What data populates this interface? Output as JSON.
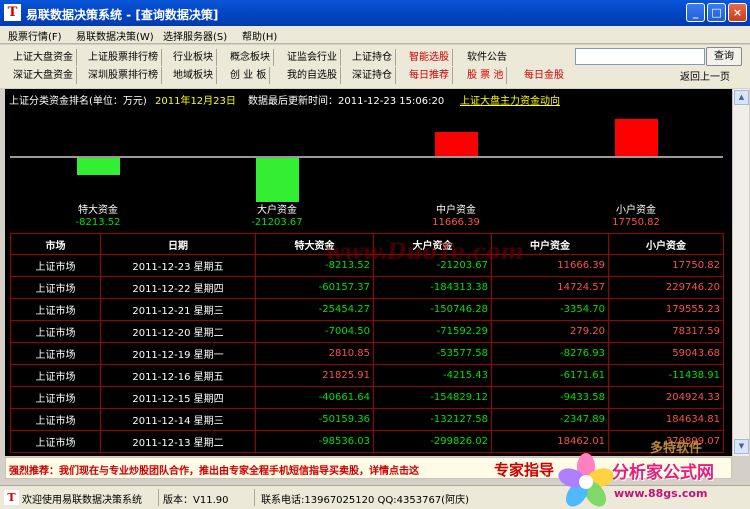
{
  "window": {
    "title": "易联数据决策系统 - [查询数据决策]",
    "buttons": {
      "minimize": "_",
      "maximize": "□",
      "close": "×"
    }
  },
  "menu": [
    "股票行情(F)",
    "易联数据决策(W)",
    "选择服务器(S)",
    "帮助(H)"
  ],
  "toolbar": {
    "row1": [
      "上证大盘资金",
      "上证股票排行榜",
      "行业板块",
      "概念板块",
      "证监会行业",
      "上证持仓",
      "智能选股",
      "软件公告"
    ],
    "row2": [
      "深证大盘资金",
      "深圳股票排行榜",
      "地域板块",
      "创 业 板",
      "我的自选股",
      "深证持仓",
      "每日推荐",
      "股 票 池",
      "每日金股"
    ],
    "search_value": "",
    "search_button": "查询",
    "back_link": "返回上一页"
  },
  "info": {
    "label": "上证分类资金排名(单位：万元)",
    "date": "2011年12月23日",
    "updated": "数据最后更新时间：2011-12-23 15:06:20",
    "link": "上证大盘主力资金动向"
  },
  "chart_data": {
    "type": "bar",
    "categories": [
      "特大资金",
      "大户资金",
      "中户资金",
      "小户资金"
    ],
    "values": [
      -8213.52,
      -21203.67,
      11666.39,
      17750.82
    ],
    "value_labels": [
      "-8213.52",
      "-21203.67",
      "11666.39",
      "17750.82"
    ],
    "colors": {
      "positive": "#ff0000",
      "negative": "#33ee33"
    }
  },
  "table": {
    "headers": [
      "市场",
      "日期",
      "特大资金",
      "大户资金",
      "中户资金",
      "小户资金"
    ],
    "rows": [
      [
        "上证市场",
        "2011-12-23  星期五",
        "-8213.52",
        "-21203.67",
        "11666.39",
        "17750.82"
      ],
      [
        "上证市场",
        "2011-12-22  星期四",
        "-60157.37",
        "-184313.38",
        "14724.57",
        "229746.20"
      ],
      [
        "上证市场",
        "2011-12-21  星期三",
        "-25454.27",
        "-150746.28",
        "-3354.70",
        "179555.23"
      ],
      [
        "上证市场",
        "2011-12-20  星期二",
        "-7004.50",
        "-71592.29",
        "279.20",
        "78317.59"
      ],
      [
        "上证市场",
        "2011-12-19  星期一",
        "2810.85",
        "-53577.58",
        "-8276.93",
        "59043.68"
      ],
      [
        "上证市场",
        "2011-12-16  星期五",
        "21825.91",
        "-4215.43",
        "-6171.61",
        "-11438.91"
      ],
      [
        "上证市场",
        "2011-12-15  星期四",
        "-40661.64",
        "-154829.12",
        "-9433.58",
        "204924.33"
      ],
      [
        "上证市场",
        "2011-12-14  星期三",
        "-50159.36",
        "-132127.58",
        "-2347.89",
        "184634.81"
      ],
      [
        "上证市场",
        "2011-12-13  星期二",
        "-98536.03",
        "-299826.02",
        "18462.01",
        "379899.07"
      ]
    ]
  },
  "watermark": "www.DuoTe.com",
  "banner": {
    "text": "强烈推荐：我们现在与专业炒股团队合作，推出由专家全程手机短信指导买卖股，详情点击这",
    "tag": "专家指导"
  },
  "status": {
    "welcome": "欢迎使用易联数据决策系统",
    "version": "版本：V11.90",
    "contact": "联系电话:13967025120 QQ:4353767(阿庆)"
  },
  "overlay": {
    "title": "分析家公式网",
    "url": "www.88gs.com",
    "small": "多特软件"
  }
}
